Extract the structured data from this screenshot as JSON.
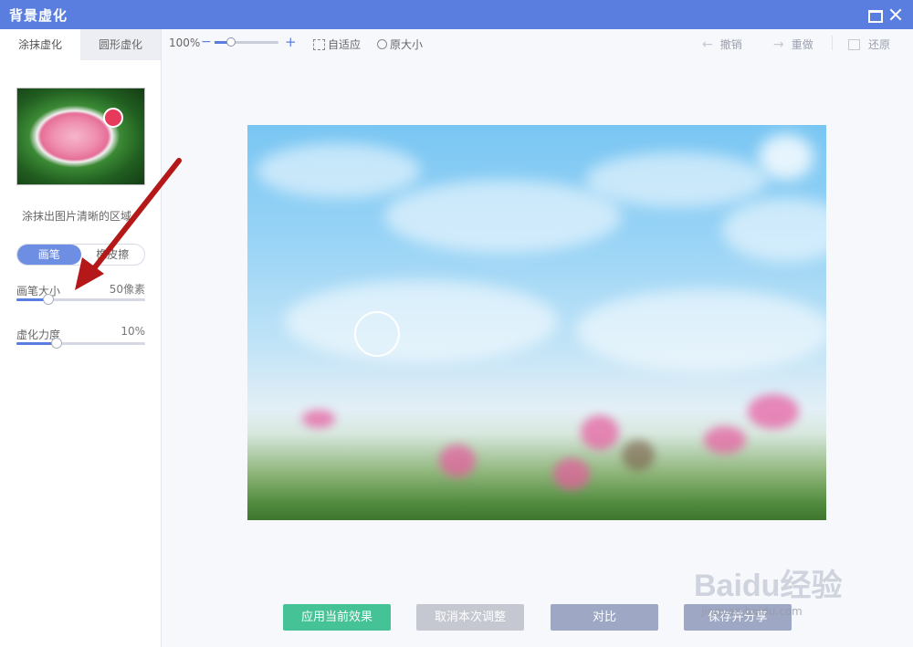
{
  "window": {
    "title": "背景虚化"
  },
  "left_panel": {
    "tabs": [
      {
        "label": "涂抹虚化",
        "active": true
      },
      {
        "label": "圆形虚化",
        "active": false
      }
    ],
    "hint": "涂抹出图片清晰的区域",
    "tools": [
      {
        "label": "画笔",
        "active": true
      },
      {
        "label": "橡皮擦",
        "active": false
      }
    ],
    "brush_size": {
      "label": "画笔大小",
      "value_text": "50像素",
      "level": 0.25
    },
    "blur_strength": {
      "label": "虚化力度",
      "value_text": "10%",
      "level": 0.31
    }
  },
  "toolbar": {
    "zoom_text": "100%",
    "zoom_minus": "−",
    "zoom_plus": "+",
    "zoom_level": 0.25,
    "fit_label": "自适应",
    "original_label": "原大小",
    "undo_label": "撤销",
    "redo_label": "重做",
    "restore_label": "还原"
  },
  "buttons": {
    "apply": "应用当前效果",
    "cancel": "取消本次调整",
    "compare": "对比",
    "save": "保存并分享"
  },
  "watermark": {
    "text": "Baidu经验",
    "sub": "jingyan.baidu.com"
  },
  "colors": {
    "titlebar": "#5a7de0",
    "apply": "#46c396",
    "annotation_arrow": "#b51818"
  }
}
